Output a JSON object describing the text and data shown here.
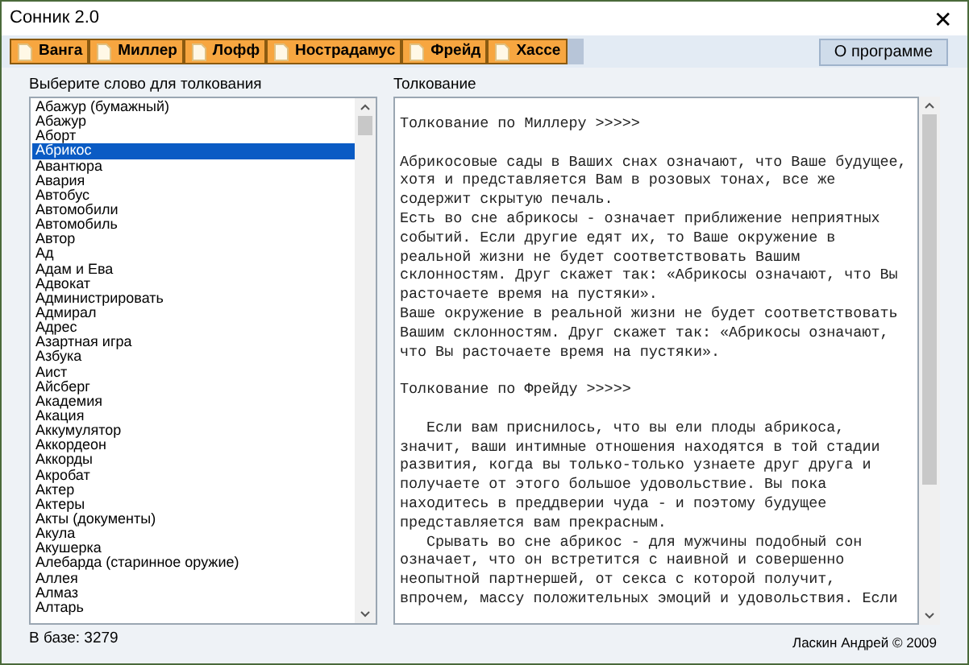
{
  "window": {
    "title": "Сонник 2.0",
    "close": "✕"
  },
  "tabs": [
    {
      "label": "Ванга",
      "selected": false
    },
    {
      "label": "Миллер",
      "selected": false
    },
    {
      "label": "Лофф",
      "selected": false
    },
    {
      "label": "Нострадамус",
      "selected": false
    },
    {
      "label": "Фрейд",
      "selected": false
    },
    {
      "label": "Хассе",
      "selected": false
    }
  ],
  "about_button": "О программе",
  "word_list": {
    "label": "Выберите слово для толкования",
    "items": [
      {
        "text": "Абажур (бумажный)",
        "selected": false
      },
      {
        "text": "Абажур",
        "selected": false
      },
      {
        "text": "Аборт",
        "selected": false
      },
      {
        "text": "Абрикос",
        "selected": true
      },
      {
        "text": "Авантюра",
        "selected": false
      },
      {
        "text": "Авария",
        "selected": false
      },
      {
        "text": "Автобус",
        "selected": false
      },
      {
        "text": "Автомобили",
        "selected": false
      },
      {
        "text": "Автомобиль",
        "selected": false
      },
      {
        "text": "Автор",
        "selected": false
      },
      {
        "text": "Ад",
        "selected": false
      },
      {
        "text": "Адам и Ева",
        "selected": false
      },
      {
        "text": "Адвокат",
        "selected": false
      },
      {
        "text": "Администрировать",
        "selected": false
      },
      {
        "text": "Адмирал",
        "selected": false
      },
      {
        "text": "Адрес",
        "selected": false
      },
      {
        "text": "Азартная игра",
        "selected": false
      },
      {
        "text": "Азбука",
        "selected": false
      },
      {
        "text": "Аист",
        "selected": false
      },
      {
        "text": "Айсберг",
        "selected": false
      },
      {
        "text": "Академия",
        "selected": false
      },
      {
        "text": "Акация",
        "selected": false
      },
      {
        "text": "Аккумулятор",
        "selected": false
      },
      {
        "text": "Аккордеон",
        "selected": false
      },
      {
        "text": "Аккорды",
        "selected": false
      },
      {
        "text": "Акробат",
        "selected": false
      },
      {
        "text": "Актер",
        "selected": false
      },
      {
        "text": "Актеры",
        "selected": false
      },
      {
        "text": "Акты (документы)",
        "selected": false
      },
      {
        "text": "Акула",
        "selected": false
      },
      {
        "text": "Акушерка",
        "selected": false
      },
      {
        "text": "Алебарда (старинное оружие)",
        "selected": false
      },
      {
        "text": "Аллея",
        "selected": false
      },
      {
        "text": "Алмаз",
        "selected": false
      },
      {
        "text": "Алтарь",
        "selected": false
      }
    ],
    "count": "В базе: 3279"
  },
  "interpretation": {
    "label": "Толкование",
    "blocks": [
      "Толкование по Миллеру >>>>>",
      "Абрикосовые сады в Ваших снах означают, что Ваше будущее,\nхотя и представляется Вам в розовых тонах, все же\nсодержит скрытую печаль.\nЕсть во сне абрикосы - означает приближение неприятных\nсобытий. Если другие едят их, то Ваше окружение в\nреальной жизни не будет соответствовать Вашим\nсклонностям. Друг скажет так: «Абрикосы означают, что Вы\nрасточаете время на пустяки».\nВаше окружение в реальной жизни не будет соответствовать\nВашим склонностям. Друг скажет так: «Абрикосы означают,\nчто Вы расточаете время на пустяки».",
      "Толкование по Фрейду >>>>>",
      "   Если вам приснилось, что вы ели плоды абрикоса,\nзначит, ваши интимные отношения находятся в той стадии\nразвития, когда вы только-только узнаете друг друга и\nполучаете от этого большое удовольствие. Вы пока\nнаходитесь в преддверии чуда - и поэтому будущее\nпредставляется вам прекрасным.\n   Срывать во сне абрикос - для мужчины подобный сон\nозначает, что он встретится с наивной и совершенно\nнеопытной партнершей, от секса с которой получит,\nвпрочем, массу положительных эмоций и удовольствия. Если"
    ]
  },
  "footer": "Ласкин Андрей © 2009"
}
